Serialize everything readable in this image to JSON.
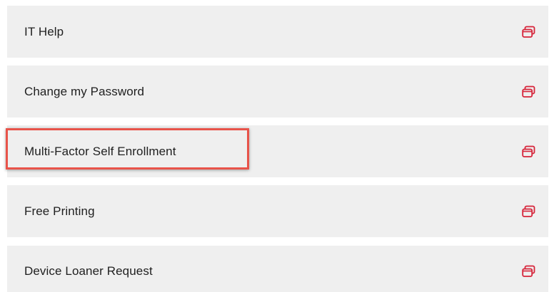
{
  "links": [
    {
      "label": "IT Help",
      "icon": "external-window-icon"
    },
    {
      "label": "Change my Password",
      "icon": "external-window-icon"
    },
    {
      "label": "Multi-Factor Self Enrollment",
      "icon": "external-window-icon"
    },
    {
      "label": "Free Printing",
      "icon": "external-window-icon"
    },
    {
      "label": "Device Loaner Request",
      "icon": "external-window-icon"
    }
  ],
  "colors": {
    "row_background": "#efefef",
    "icon_accent": "#d6243a",
    "highlight_border": "#e8534a",
    "text": "#1f1f1f"
  },
  "highlighted_item": "Multi-Factor Self Enrollment"
}
